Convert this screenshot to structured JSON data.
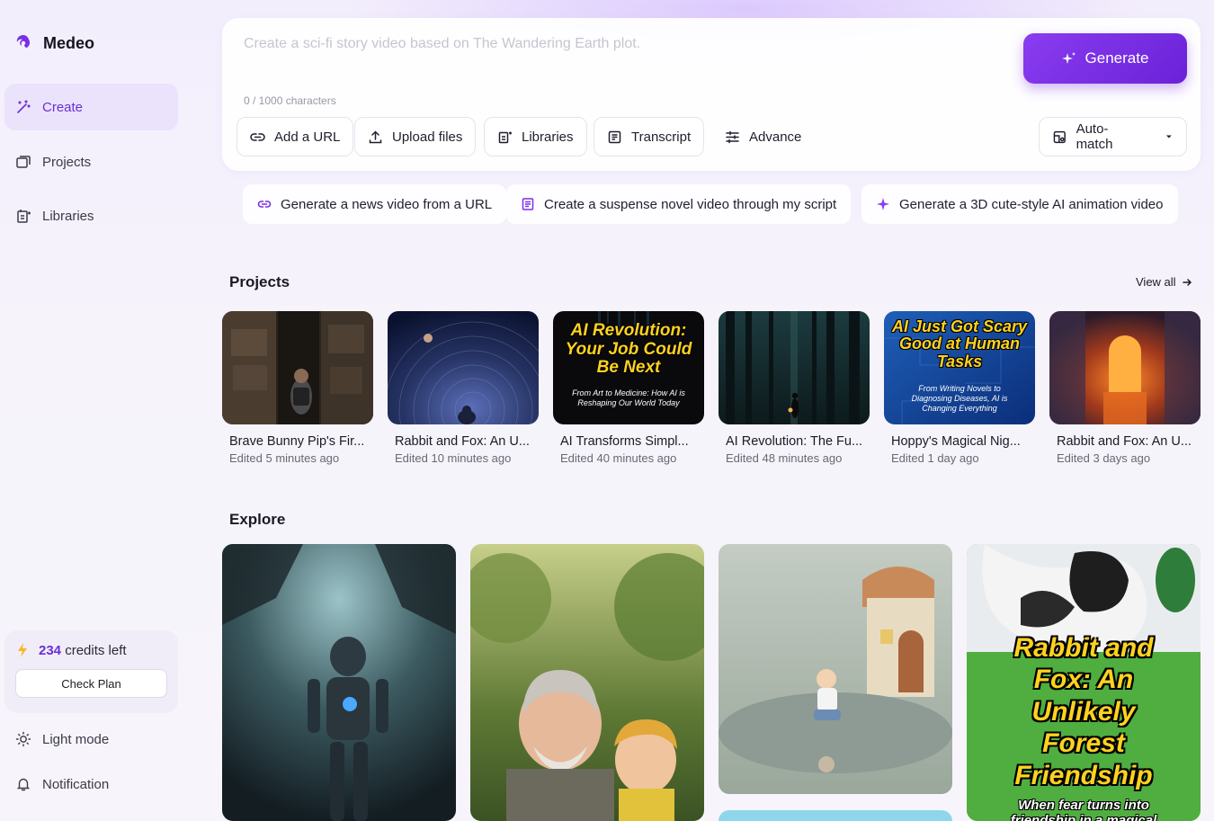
{
  "app": {
    "name": "Medeo"
  },
  "sidebar": {
    "items": [
      {
        "label": "Create",
        "icon": "magic-wand-icon",
        "active": true
      },
      {
        "label": "Projects",
        "icon": "projects-icon",
        "active": false
      },
      {
        "label": "Libraries",
        "icon": "libraries-icon",
        "active": false
      }
    ],
    "credits": {
      "count": "234",
      "label": "credits left",
      "button": "Check Plan"
    },
    "footer": [
      {
        "label": "Light mode",
        "icon": "sun-icon"
      },
      {
        "label": "Notification",
        "icon": "bell-icon"
      }
    ]
  },
  "prompt": {
    "placeholder": "Create a sci-fi story video based on The Wandering Earth plot.",
    "char_count": "0 / 1000 characters",
    "generate_label": "Generate",
    "tools": [
      "Add a URL",
      "Upload files",
      "Libraries",
      "Transcript",
      "Advance"
    ],
    "auto_match": "Auto-match"
  },
  "suggestions": [
    "Generate a news video from a URL",
    "Create a suspense novel video through my script",
    "Generate a 3D cute-style AI animation video"
  ],
  "projects": {
    "title": "Projects",
    "view_all": "View all",
    "items": [
      {
        "title": "Brave Bunny Pip's Fir...",
        "edited": "Edited 5 minutes ago"
      },
      {
        "title": "Rabbit and Fox: An U...",
        "edited": "Edited 10 minutes ago"
      },
      {
        "title": "AI Transforms Simpl...",
        "edited": "Edited 40 minutes ago",
        "thumb_text": "AI Revolution: Your Job Could Be Next",
        "thumb_sub": "From Art to Medicine: How AI is Reshaping Our World Today"
      },
      {
        "title": "AI Revolution: The Fu...",
        "edited": "Edited 48 minutes ago"
      },
      {
        "title": "Hoppy's Magical Nig...",
        "edited": "Edited 1 day ago",
        "thumb_text": "AI Just Got Scary Good at Human Tasks",
        "thumb_sub": "From Writing Novels to Diagnosing Diseases, AI is Changing Everything"
      },
      {
        "title": "Rabbit and Fox: An U...",
        "edited": "Edited 3 days ago"
      }
    ]
  },
  "explore": {
    "title": "Explore",
    "card4_text": "Rabbit and Fox: An Unlikely Forest Friendship",
    "card4_sub": "When fear turns into friendship in a magical"
  },
  "colors": {
    "accent": "#6b2fd6",
    "generate": "#7a2fe4",
    "thumb_text": "#ffd21f"
  }
}
